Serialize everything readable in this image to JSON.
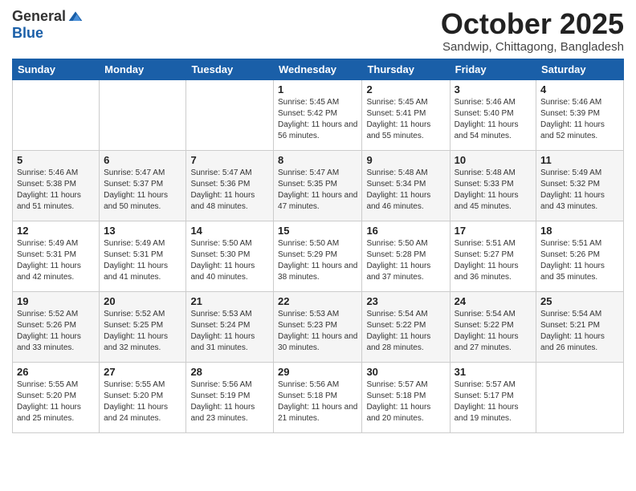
{
  "logo": {
    "general": "General",
    "blue": "Blue"
  },
  "title": {
    "month": "October 2025",
    "location": "Sandwip, Chittagong, Bangladesh"
  },
  "weekdays": [
    "Sunday",
    "Monday",
    "Tuesday",
    "Wednesday",
    "Thursday",
    "Friday",
    "Saturday"
  ],
  "weeks": [
    [
      {
        "day": "",
        "sunrise": "",
        "sunset": "",
        "daylight": ""
      },
      {
        "day": "",
        "sunrise": "",
        "sunset": "",
        "daylight": ""
      },
      {
        "day": "",
        "sunrise": "",
        "sunset": "",
        "daylight": ""
      },
      {
        "day": "1",
        "sunrise": "Sunrise: 5:45 AM",
        "sunset": "Sunset: 5:42 PM",
        "daylight": "Daylight: 11 hours and 56 minutes."
      },
      {
        "day": "2",
        "sunrise": "Sunrise: 5:45 AM",
        "sunset": "Sunset: 5:41 PM",
        "daylight": "Daylight: 11 hours and 55 minutes."
      },
      {
        "day": "3",
        "sunrise": "Sunrise: 5:46 AM",
        "sunset": "Sunset: 5:40 PM",
        "daylight": "Daylight: 11 hours and 54 minutes."
      },
      {
        "day": "4",
        "sunrise": "Sunrise: 5:46 AM",
        "sunset": "Sunset: 5:39 PM",
        "daylight": "Daylight: 11 hours and 52 minutes."
      }
    ],
    [
      {
        "day": "5",
        "sunrise": "Sunrise: 5:46 AM",
        "sunset": "Sunset: 5:38 PM",
        "daylight": "Daylight: 11 hours and 51 minutes."
      },
      {
        "day": "6",
        "sunrise": "Sunrise: 5:47 AM",
        "sunset": "Sunset: 5:37 PM",
        "daylight": "Daylight: 11 hours and 50 minutes."
      },
      {
        "day": "7",
        "sunrise": "Sunrise: 5:47 AM",
        "sunset": "Sunset: 5:36 PM",
        "daylight": "Daylight: 11 hours and 48 minutes."
      },
      {
        "day": "8",
        "sunrise": "Sunrise: 5:47 AM",
        "sunset": "Sunset: 5:35 PM",
        "daylight": "Daylight: 11 hours and 47 minutes."
      },
      {
        "day": "9",
        "sunrise": "Sunrise: 5:48 AM",
        "sunset": "Sunset: 5:34 PM",
        "daylight": "Daylight: 11 hours and 46 minutes."
      },
      {
        "day": "10",
        "sunrise": "Sunrise: 5:48 AM",
        "sunset": "Sunset: 5:33 PM",
        "daylight": "Daylight: 11 hours and 45 minutes."
      },
      {
        "day": "11",
        "sunrise": "Sunrise: 5:49 AM",
        "sunset": "Sunset: 5:32 PM",
        "daylight": "Daylight: 11 hours and 43 minutes."
      }
    ],
    [
      {
        "day": "12",
        "sunrise": "Sunrise: 5:49 AM",
        "sunset": "Sunset: 5:31 PM",
        "daylight": "Daylight: 11 hours and 42 minutes."
      },
      {
        "day": "13",
        "sunrise": "Sunrise: 5:49 AM",
        "sunset": "Sunset: 5:31 PM",
        "daylight": "Daylight: 11 hours and 41 minutes."
      },
      {
        "day": "14",
        "sunrise": "Sunrise: 5:50 AM",
        "sunset": "Sunset: 5:30 PM",
        "daylight": "Daylight: 11 hours and 40 minutes."
      },
      {
        "day": "15",
        "sunrise": "Sunrise: 5:50 AM",
        "sunset": "Sunset: 5:29 PM",
        "daylight": "Daylight: 11 hours and 38 minutes."
      },
      {
        "day": "16",
        "sunrise": "Sunrise: 5:50 AM",
        "sunset": "Sunset: 5:28 PM",
        "daylight": "Daylight: 11 hours and 37 minutes."
      },
      {
        "day": "17",
        "sunrise": "Sunrise: 5:51 AM",
        "sunset": "Sunset: 5:27 PM",
        "daylight": "Daylight: 11 hours and 36 minutes."
      },
      {
        "day": "18",
        "sunrise": "Sunrise: 5:51 AM",
        "sunset": "Sunset: 5:26 PM",
        "daylight": "Daylight: 11 hours and 35 minutes."
      }
    ],
    [
      {
        "day": "19",
        "sunrise": "Sunrise: 5:52 AM",
        "sunset": "Sunset: 5:26 PM",
        "daylight": "Daylight: 11 hours and 33 minutes."
      },
      {
        "day": "20",
        "sunrise": "Sunrise: 5:52 AM",
        "sunset": "Sunset: 5:25 PM",
        "daylight": "Daylight: 11 hours and 32 minutes."
      },
      {
        "day": "21",
        "sunrise": "Sunrise: 5:53 AM",
        "sunset": "Sunset: 5:24 PM",
        "daylight": "Daylight: 11 hours and 31 minutes."
      },
      {
        "day": "22",
        "sunrise": "Sunrise: 5:53 AM",
        "sunset": "Sunset: 5:23 PM",
        "daylight": "Daylight: 11 hours and 30 minutes."
      },
      {
        "day": "23",
        "sunrise": "Sunrise: 5:54 AM",
        "sunset": "Sunset: 5:22 PM",
        "daylight": "Daylight: 11 hours and 28 minutes."
      },
      {
        "day": "24",
        "sunrise": "Sunrise: 5:54 AM",
        "sunset": "Sunset: 5:22 PM",
        "daylight": "Daylight: 11 hours and 27 minutes."
      },
      {
        "day": "25",
        "sunrise": "Sunrise: 5:54 AM",
        "sunset": "Sunset: 5:21 PM",
        "daylight": "Daylight: 11 hours and 26 minutes."
      }
    ],
    [
      {
        "day": "26",
        "sunrise": "Sunrise: 5:55 AM",
        "sunset": "Sunset: 5:20 PM",
        "daylight": "Daylight: 11 hours and 25 minutes."
      },
      {
        "day": "27",
        "sunrise": "Sunrise: 5:55 AM",
        "sunset": "Sunset: 5:20 PM",
        "daylight": "Daylight: 11 hours and 24 minutes."
      },
      {
        "day": "28",
        "sunrise": "Sunrise: 5:56 AM",
        "sunset": "Sunset: 5:19 PM",
        "daylight": "Daylight: 11 hours and 23 minutes."
      },
      {
        "day": "29",
        "sunrise": "Sunrise: 5:56 AM",
        "sunset": "Sunset: 5:18 PM",
        "daylight": "Daylight: 11 hours and 21 minutes."
      },
      {
        "day": "30",
        "sunrise": "Sunrise: 5:57 AM",
        "sunset": "Sunset: 5:18 PM",
        "daylight": "Daylight: 11 hours and 20 minutes."
      },
      {
        "day": "31",
        "sunrise": "Sunrise: 5:57 AM",
        "sunset": "Sunset: 5:17 PM",
        "daylight": "Daylight: 11 hours and 19 minutes."
      },
      {
        "day": "",
        "sunrise": "",
        "sunset": "",
        "daylight": ""
      }
    ]
  ]
}
